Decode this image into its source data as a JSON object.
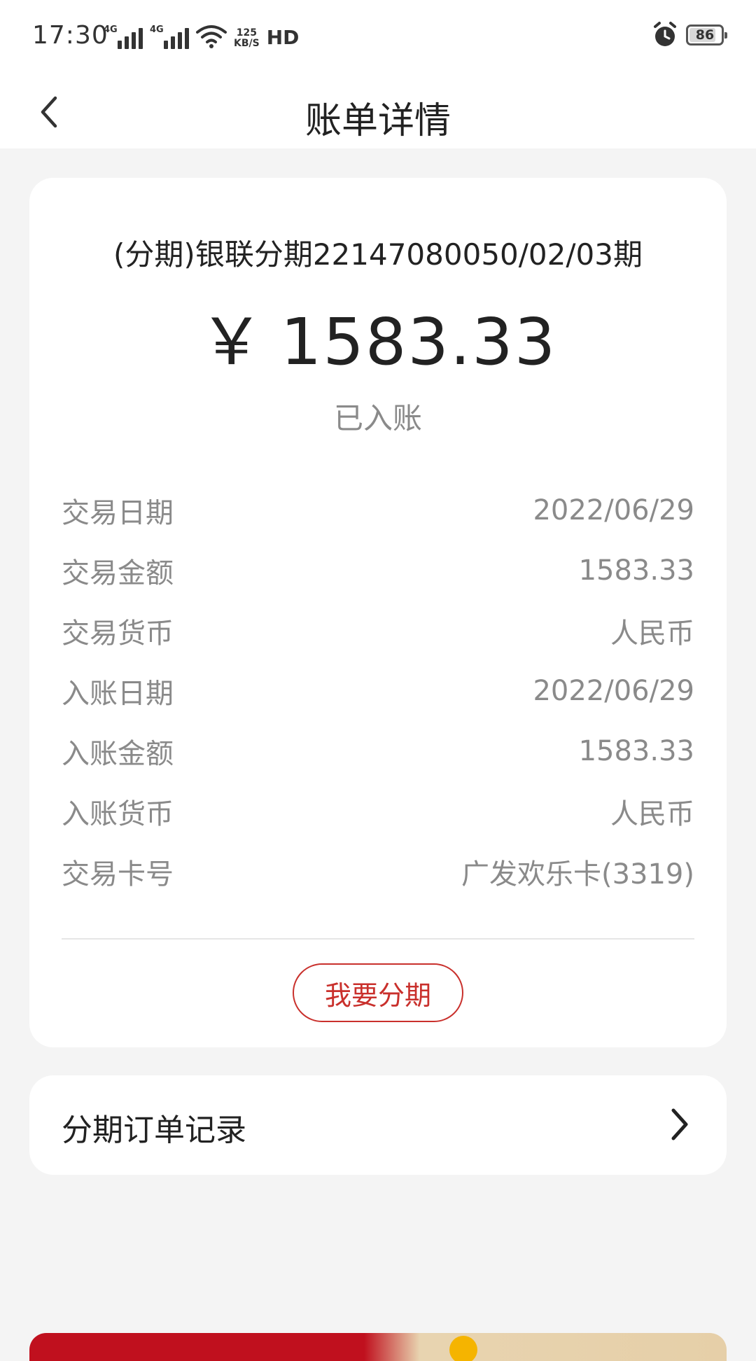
{
  "status_bar": {
    "time": "17:30",
    "network_1": "4G",
    "network_2": "4G",
    "speed_value": "125",
    "speed_unit": "KB/S",
    "hd_label": "HD",
    "battery": "86",
    "battery_level": 0.86,
    "icons": [
      "signal-icon",
      "wifi-icon",
      "alarm-icon",
      "battery-icon"
    ]
  },
  "nav": {
    "title": "账单详情",
    "back_icon": "chevron-left-icon"
  },
  "detail": {
    "title": "(分期)银联分期22147080050/02/03期",
    "currency_symbol": "￥",
    "amount": "1583.33",
    "status": "已入账",
    "rows": [
      {
        "label": "交易日期",
        "value": "2022/06/29"
      },
      {
        "label": "交易金额",
        "value": "1583.33"
      },
      {
        "label": "交易货币",
        "value": "人民币"
      },
      {
        "label": "入账日期",
        "value": "2022/06/29"
      },
      {
        "label": "入账金额",
        "value": "1583.33"
      },
      {
        "label": "入账货币",
        "value": "人民币"
      },
      {
        "label": "交易卡号",
        "value": "广发欢乐卡(3319)"
      }
    ],
    "installment_button": "我要分期"
  },
  "records": {
    "label": "分期订单记录",
    "icon": "chevron-right-icon"
  },
  "colors": {
    "accent": "#c9302c",
    "page_bg": "#f4f4f4",
    "card_bg": "#ffffff",
    "muted_text": "#8a8a8a"
  }
}
